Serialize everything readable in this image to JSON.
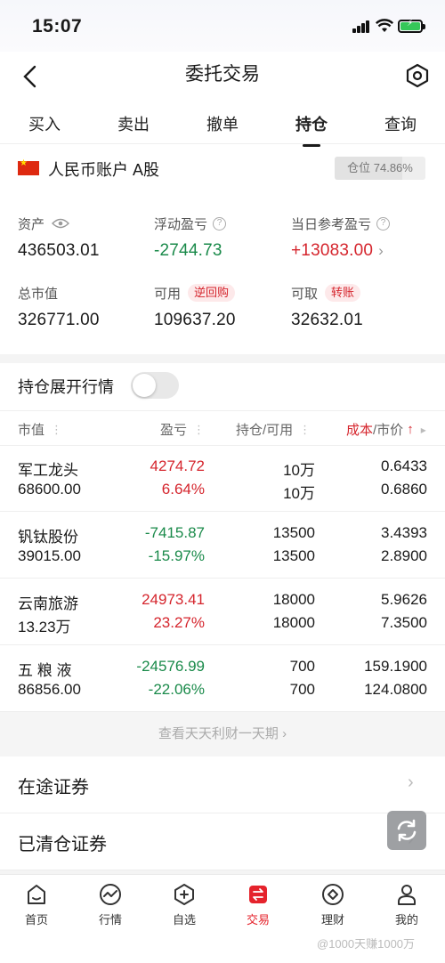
{
  "status_bar": {
    "time": "15:07"
  },
  "header": {
    "title": "委托交易"
  },
  "tabs": [
    {
      "label": "买入"
    },
    {
      "label": "卖出"
    },
    {
      "label": "撤单"
    },
    {
      "label": "持仓"
    },
    {
      "label": "查询"
    }
  ],
  "active_tab": "持仓",
  "account": {
    "name": "人民币账户 A股",
    "position_ratio_label": "仓位 74.86%",
    "position_ratio": 0.7486
  },
  "summary": {
    "assets_label": "资产",
    "assets_value": "436503.01",
    "float_pl_label": "浮动盈亏",
    "float_pl_value": "-2744.73",
    "day_pl_label": "当日参考盈亏",
    "day_pl_value": "+13083.00",
    "market_value_label": "总市值",
    "market_value": "326771.00",
    "available_label": "可用",
    "available_value": "109637.20",
    "reverse_repo_label": "逆回购",
    "withdrawable_label": "可取",
    "withdrawable_value": "32632.01",
    "transfer_label": "转账"
  },
  "expand_toggle": {
    "label": "持仓展开行情",
    "on": false
  },
  "table": {
    "headers": {
      "market_value": "市值",
      "pl": "盈亏",
      "holding": "持仓/可用",
      "cost": "成本",
      "price": "/市价",
      "sort_arrow": "↑"
    },
    "rows": [
      {
        "name": "军工龙头",
        "market_value": "68600.00",
        "pl": "4274.72",
        "pl_pct": "6.64%",
        "holding": "10万",
        "available": "10万",
        "cost": "0.6433",
        "price": "0.6860",
        "trend": "up"
      },
      {
        "name": "钒钛股份",
        "market_value": "39015.00",
        "pl": "-7415.87",
        "pl_pct": "-15.97%",
        "holding": "13500",
        "available": "13500",
        "cost": "3.4393",
        "price": "2.8900",
        "trend": "down"
      },
      {
        "name": "云南旅游",
        "market_value": "13.23万",
        "pl": "24973.41",
        "pl_pct": "23.27%",
        "holding": "18000",
        "available": "18000",
        "cost": "5.9626",
        "price": "7.3500",
        "trend": "up"
      },
      {
        "name": "五 粮 液",
        "market_value": "86856.00",
        "pl": "-24576.99",
        "pl_pct": "-22.06%",
        "holding": "700",
        "available": "700",
        "cost": "159.1900",
        "price": "124.0800",
        "trend": "down"
      }
    ]
  },
  "more_link": {
    "label": "查看天天利财一天期"
  },
  "links": [
    {
      "label": "在途证券"
    },
    {
      "label": "已清仓证券"
    }
  ],
  "bottom_nav": [
    {
      "label": "首页",
      "icon": "home-icon"
    },
    {
      "label": "行情",
      "icon": "chart-icon"
    },
    {
      "label": "自选",
      "icon": "add-watchlist-icon"
    },
    {
      "label": "交易",
      "icon": "trade-icon"
    },
    {
      "label": "理财",
      "icon": "finance-icon"
    },
    {
      "label": "我的",
      "icon": "profile-icon"
    }
  ],
  "watermark": "@1000天赚1000万",
  "colors": {
    "up": "#d5252d",
    "down": "#1a8a4a",
    "accent": "#e5232c"
  }
}
